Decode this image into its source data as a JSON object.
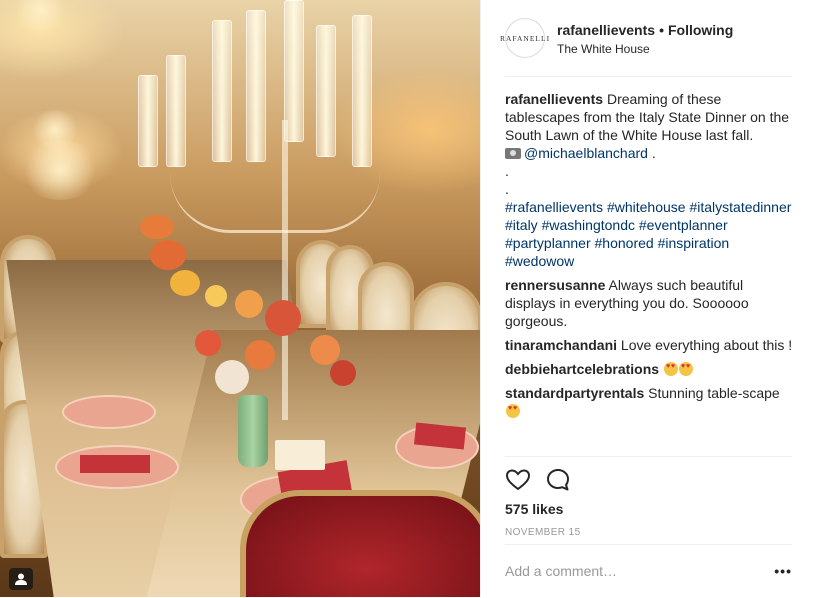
{
  "post": {
    "image_alt": "Tablescape with candelabras and floral arrangements"
  },
  "header": {
    "avatar_text": "RAFANELLI",
    "username": "rafanellievents",
    "separator": "•",
    "follow_status": "Following",
    "location": "The White House"
  },
  "caption": {
    "username": "rafanellievents",
    "text": "Dreaming of these tablescapes from the Italy State Dinner on the South Lawn of the White House last fall.",
    "credit_mention": "@michaelblanchard",
    "credit_suffix": " .",
    "dot1": ".",
    "dot2": ".",
    "hashtags": [
      "#rafanellievents",
      "#whitehouse",
      "#italystatedinner",
      "#italy",
      "#washingtondc",
      "#eventplanner",
      "#partyplanner",
      "#honored",
      "#inspiration",
      "#wedowow"
    ]
  },
  "comments": [
    {
      "username": "rennersusanne",
      "text": "Always such beautiful displays in everything you do. Soooooo gorgeous."
    },
    {
      "username": "tinaramchandani",
      "text": "Love everything about this !"
    },
    {
      "username": "debbiehartcelebrations",
      "text": ""
    },
    {
      "username": "standardpartyrentals",
      "text": "Stunning table-scape"
    }
  ],
  "actions": {
    "likes": "575 likes",
    "date": "NOVEMBER 15"
  },
  "add_comment": {
    "placeholder": "Add a comment…",
    "more_label": "•••"
  },
  "icons": {
    "like": "heart-icon",
    "comment": "comment-bubble-icon",
    "photo_tag": "user-tag-icon"
  },
  "colors": {
    "link": "#003569",
    "text": "#262626",
    "muted": "#999999"
  }
}
